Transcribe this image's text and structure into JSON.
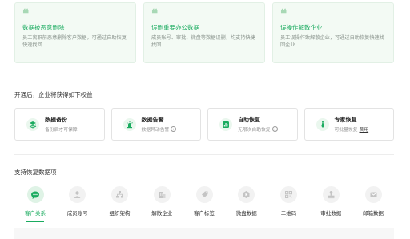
{
  "scenarios": [
    {
      "title": "数据被恶意删除",
      "desc": "员工离职前恶意删除客户数据，可通过自助恢复快速找回"
    },
    {
      "title": "误删重要办公数据",
      "desc": "成员账号、审批、微盘等数据误删，均支持快捷找回"
    },
    {
      "title": "误操作解散企业",
      "desc": "员工误操作致解散企业，可通过自助恢复快速找回企业"
    }
  ],
  "benefits": {
    "heading": "开通后，企业将获得如下权益",
    "items": [
      {
        "title": "数据备份",
        "desc": "备份后才可保障",
        "icon": "database-icon"
      },
      {
        "title": "数据告警",
        "desc": "数据异动告警",
        "icon": "alarm-icon"
      },
      {
        "title": "自助恢复",
        "desc": "无限次自助恢复",
        "icon": "restore-chart-icon"
      },
      {
        "title": "专家恢复",
        "desc": "可批量恢复",
        "link": "费用",
        "icon": "expert-tie-icon"
      }
    ]
  },
  "recovery": {
    "heading": "支持恢复数据项",
    "types": [
      {
        "label": "客户关系",
        "icon": "chat-icon",
        "active": true
      },
      {
        "label": "成员账号",
        "icon": "person-icon"
      },
      {
        "label": "组织架构",
        "icon": "org-chart-icon"
      },
      {
        "label": "解散企业",
        "icon": "building-icon"
      },
      {
        "label": "客户标签",
        "icon": "tag-icon"
      },
      {
        "label": "微盘数据",
        "icon": "cloud-drive-icon"
      },
      {
        "label": "二维码",
        "icon": "qr-code-icon"
      },
      {
        "label": "审批数据",
        "icon": "stamp-icon"
      },
      {
        "label": "邮箱数据",
        "icon": "mail-icon"
      }
    ]
  },
  "colors": {
    "accent": "#1aab5f",
    "card_bg": "#f3faf4",
    "icon_gray": "#c4c4c4"
  }
}
